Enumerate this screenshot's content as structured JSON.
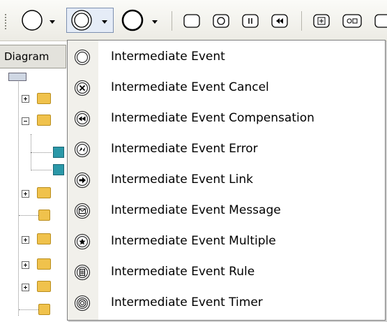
{
  "left_panel": {
    "tab_label": "Diagram"
  },
  "menu": {
    "items": [
      {
        "label": "Intermediate Event",
        "icon": "intermediate-event-icon"
      },
      {
        "label": "Intermediate Event Cancel",
        "icon": "intermediate-event-cancel-icon"
      },
      {
        "label": "Intermediate Event Compensation",
        "icon": "intermediate-event-compensation-icon"
      },
      {
        "label": "Intermediate Event Error",
        "icon": "intermediate-event-error-icon"
      },
      {
        "label": "Intermediate Event Link",
        "icon": "intermediate-event-link-icon"
      },
      {
        "label": "Intermediate Event Message",
        "icon": "intermediate-event-message-icon"
      },
      {
        "label": "Intermediate Event Multiple",
        "icon": "intermediate-event-multiple-icon"
      },
      {
        "label": "Intermediate Event Rule",
        "icon": "intermediate-event-rule-icon"
      },
      {
        "label": "Intermediate Event Timer",
        "icon": "intermediate-event-timer-icon"
      }
    ]
  },
  "colors": {
    "menu_gutter": "#f1f0eb",
    "toolbar_active": "#e5ecf7",
    "folder": "#f0c24c"
  }
}
